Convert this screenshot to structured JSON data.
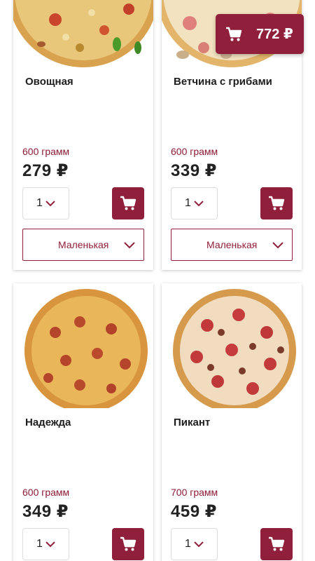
{
  "currency_symbol": "₽",
  "colors": {
    "accent": "#8f1f3a",
    "weight_text": "#8a1c34"
  },
  "cart": {
    "total": "772 ₽",
    "icon": "shopping-cart-icon"
  },
  "products": [
    {
      "name": "Овощная",
      "weight": "600 грамм",
      "price": "279 ₽",
      "quantity": "1",
      "size": "Маленькая"
    },
    {
      "name": "Ветчина с грибами",
      "weight": "600 грамм",
      "price": "339 ₽",
      "quantity": "1",
      "size": "Маленькая"
    },
    {
      "name": "Надежда",
      "weight": "600 грамм",
      "price": "349 ₽",
      "quantity": "1"
    },
    {
      "name": "Пикант",
      "weight": "700 грамм",
      "price": "459 ₽",
      "quantity": "1"
    }
  ]
}
